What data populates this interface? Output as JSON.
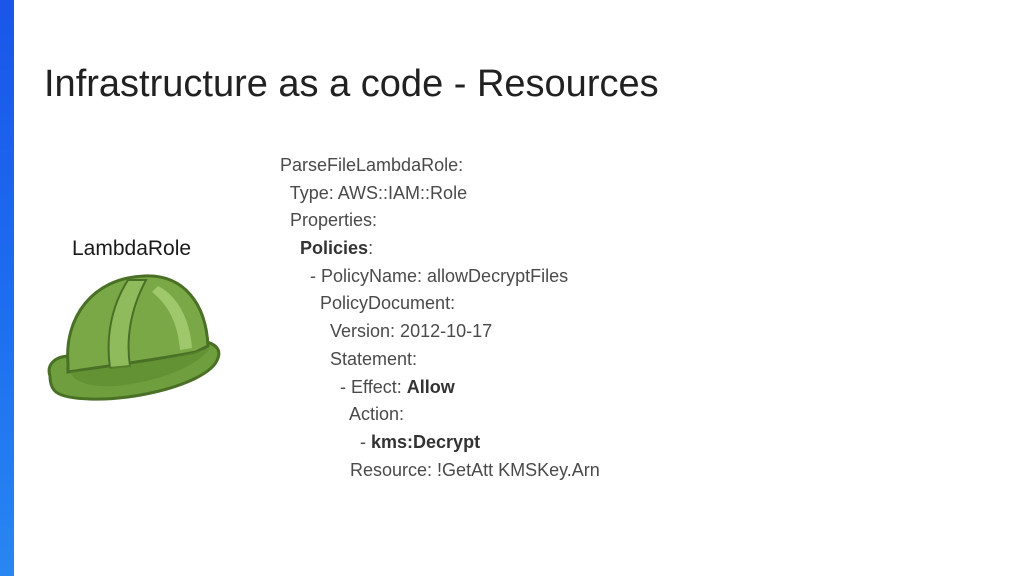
{
  "slide": {
    "title": "Infrastructure as a code - Resources",
    "role_label": "LambdaRole"
  },
  "colors": {
    "accent": "#1e6ef0",
    "helmet_green": "#6f9e3e",
    "helmet_dark": "#4a7026",
    "text": "#4a4a4a"
  },
  "icon": "hard-hat-icon",
  "code": {
    "lines": [
      {
        "indent": "",
        "text": "ParseFileLambdaRole:",
        "bold": "",
        "suffix": ""
      },
      {
        "indent": "  ",
        "text": "Type: AWS::IAM::Role",
        "bold": "",
        "suffix": ""
      },
      {
        "indent": "  ",
        "text": "Properties:",
        "bold": "",
        "suffix": ""
      },
      {
        "indent": "    ",
        "text": "",
        "bold": "Policies",
        "suffix": ":"
      },
      {
        "indent": "      ",
        "text": "- PolicyName: allowDecryptFiles",
        "bold": "",
        "suffix": ""
      },
      {
        "indent": "        ",
        "text": "PolicyDocument:",
        "bold": "",
        "suffix": ""
      },
      {
        "indent": "          ",
        "text": "Version: 2012-10-17",
        "bold": "",
        "suffix": ""
      },
      {
        "indent": "          ",
        "text": "Statement:",
        "bold": "",
        "suffix": ""
      },
      {
        "indent": "            ",
        "text": "- Effect: ",
        "bold": "Allow",
        "suffix": ""
      },
      {
        "indent": "              ",
        "text": "Action:",
        "bold": "",
        "suffix": ""
      },
      {
        "indent": "                ",
        "text": "- ",
        "bold": "kms:Decrypt",
        "suffix": ""
      },
      {
        "indent": "              ",
        "text": "Resource: !GetAtt KMSKey.Arn",
        "bold": "",
        "suffix": ""
      }
    ]
  }
}
